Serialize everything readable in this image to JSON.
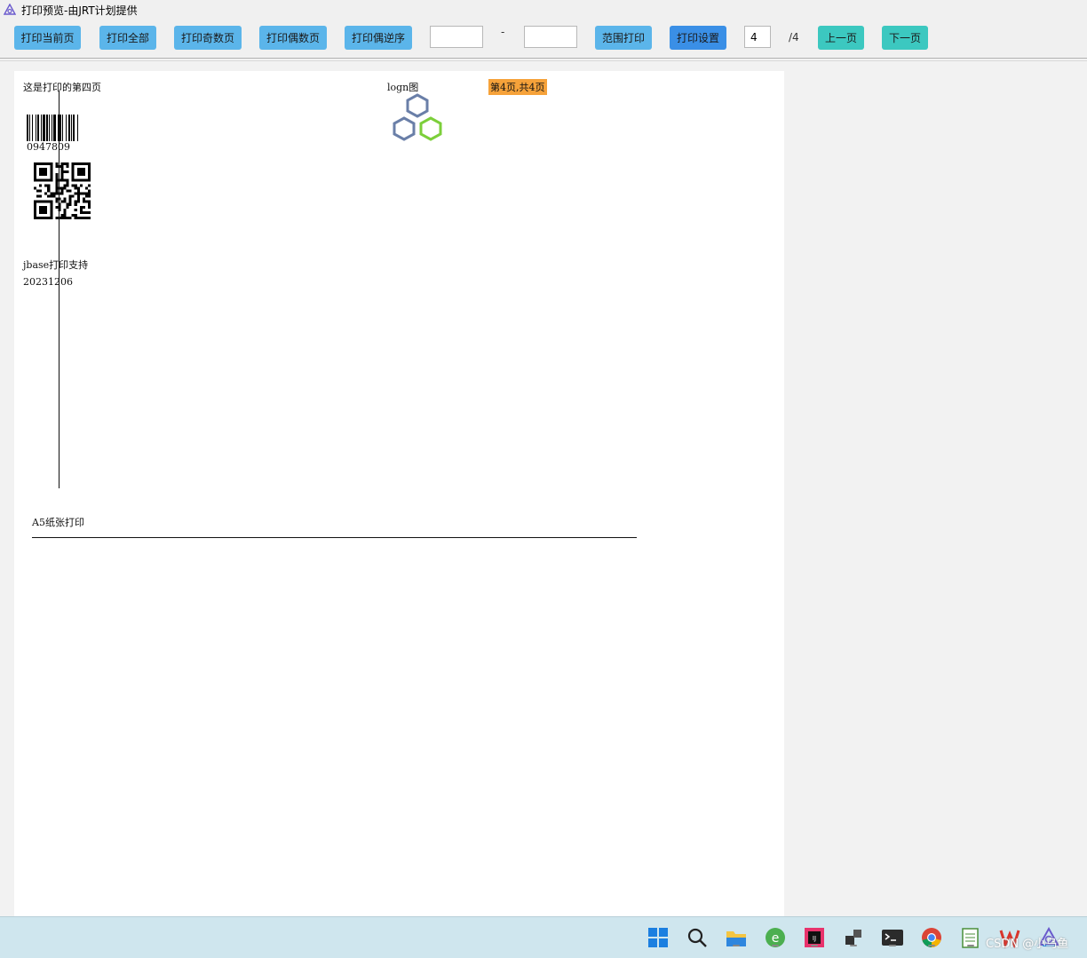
{
  "window": {
    "title": "打印预览-由JRT计划提供"
  },
  "toolbar": {
    "print_current": "打印当前页",
    "print_all": "打印全部",
    "print_odd": "打印奇数页",
    "print_even": "打印偶数页",
    "print_even_reverse": "打印偶逆序",
    "range_from": "",
    "range_separator": "-",
    "range_to": "",
    "print_range": "范围打印",
    "print_settings": "打印设置",
    "page_number": "4",
    "page_total": "/4",
    "prev_page": "上一页",
    "next_page": "下一页"
  },
  "paper": {
    "heading": "这是打印的第四页",
    "logo_label": "logn图",
    "page_badge": "第4页,共4页",
    "barcode_text": "0947809",
    "support_text": "jbase打印支持",
    "date_text": "20231206",
    "paper_size_text": "A5纸张打印",
    "badge_color": "#f6a23a"
  },
  "taskbar": {
    "icons": [
      "windows-start-icon",
      "search-icon",
      "file-explorer-icon",
      "edge-browser-icon",
      "intellij-icon",
      "task-view-icon",
      "terminal-icon",
      "chrome-icon",
      "notepad-icon",
      "wps-icon",
      "jrt-app-icon"
    ],
    "watermark": "CSDN @小乌鱼"
  }
}
